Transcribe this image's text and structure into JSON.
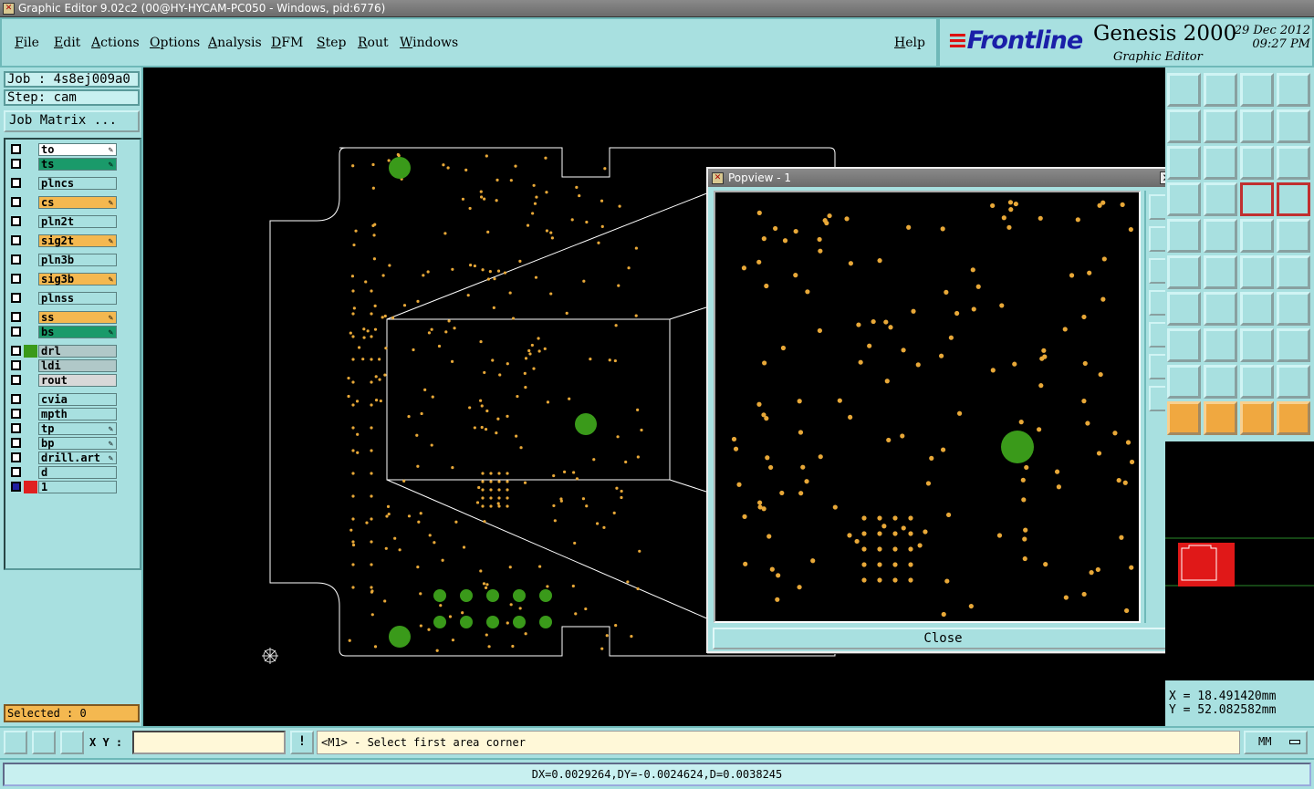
{
  "window": {
    "title": "Graphic Editor 9.02c2 (00@HY-HYCAM-PC050 - Windows, pid:6776)"
  },
  "menu": {
    "items": [
      "File",
      "Edit",
      "Actions",
      "Options",
      "Analysis",
      "DFM",
      "Step",
      "Rout",
      "Windows"
    ],
    "help": "Help"
  },
  "brand": {
    "logo": "Frontline",
    "app": "Genesis 2000",
    "subtitle": "Graphic Editor",
    "date": "29 Dec 2012",
    "time": "09:27 PM"
  },
  "job": {
    "job_label": "Job : 4s8ej009a0",
    "step_label": "Step: cam",
    "matrix_button": "Job Matrix ..."
  },
  "layers": [
    {
      "name": "to",
      "color": "#ffffff",
      "editable": true
    },
    {
      "name": "ts",
      "color": "#1a9a6a",
      "editable": true
    },
    {
      "name": "plncs",
      "color": "#a8e0e0",
      "editable": false
    },
    {
      "name": "cs",
      "color": "#f4b850",
      "editable": true
    },
    {
      "name": "pln2t",
      "color": "#a8e0e0",
      "editable": false
    },
    {
      "name": "sig2t",
      "color": "#f4b850",
      "editable": true
    },
    {
      "name": "pln3b",
      "color": "#a8e0e0",
      "editable": false
    },
    {
      "name": "sig3b",
      "color": "#f4b850",
      "editable": true
    },
    {
      "name": "plnss",
      "color": "#a8e0e0",
      "editable": false
    },
    {
      "name": "ss",
      "color": "#f4b850",
      "editable": true
    },
    {
      "name": "bs",
      "color": "#1a9a6a",
      "editable": true
    },
    {
      "name": "drl",
      "color": "#b0c8c8",
      "editable": false,
      "active_color": "#3a9a1a"
    },
    {
      "name": "ldi",
      "color": "#b0c8c8",
      "editable": false
    },
    {
      "name": "rout",
      "color": "#d8d8d8",
      "editable": false
    },
    {
      "name": "cvia",
      "color": "#a8e0e0",
      "editable": false
    },
    {
      "name": "mpth",
      "color": "#a8e0e0",
      "editable": false
    },
    {
      "name": "tp",
      "color": "#a8e0e0",
      "editable": true
    },
    {
      "name": "bp",
      "color": "#a8e0e0",
      "editable": true
    },
    {
      "name": "drill.art",
      "color": "#a8e0e0",
      "editable": true
    },
    {
      "name": "d",
      "color": "#a8e0e0",
      "editable": false
    },
    {
      "name": "1",
      "color": "#a8e0e0",
      "editable": false,
      "active_color": "#e02020"
    }
  ],
  "selected_label": "Selected : 0",
  "popview": {
    "title": "Popview - 1",
    "close_label": "Close"
  },
  "coords": {
    "x": "X = 18.491420mm",
    "y": "Y = 52.082582mm"
  },
  "bottom": {
    "xy_label": "X Y :",
    "xy_value": "",
    "warn": "!",
    "prompt": "<M1> - Select first area corner",
    "units": "MM"
  },
  "status": "DX=0.0029264,DY=-0.0024624,D=0.0038245",
  "colors": {
    "pad": "#e8a838",
    "drill": "#3a9a1a",
    "outline": "#ffffff",
    "panel": "#a8e0e0"
  }
}
